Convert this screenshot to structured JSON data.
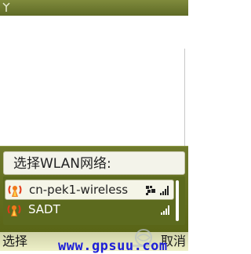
{
  "dialog": {
    "title": "选择WLAN网络:",
    "networks": [
      {
        "name": "cn-pek1-wireless",
        "secured": true,
        "highlighted": true,
        "icon": "wlan-access-point-icon"
      },
      {
        "name": "SADT",
        "secured": false,
        "highlighted": false,
        "icon": "wlan-access-point-icon"
      }
    ]
  },
  "softkeys": {
    "left": "选择",
    "right": "取消"
  },
  "watermark": {
    "text": "www.gpsuu.com"
  },
  "icons": {
    "status": "antenna-icon",
    "secure": "lock-icon",
    "strength": "signal-strength-icon"
  },
  "colors": {
    "status_bar": "#6f7a30",
    "dialog_bg": "#5c6a1e",
    "highlight_bg": "#f5f5e8",
    "watermark": "#1e20d8"
  }
}
